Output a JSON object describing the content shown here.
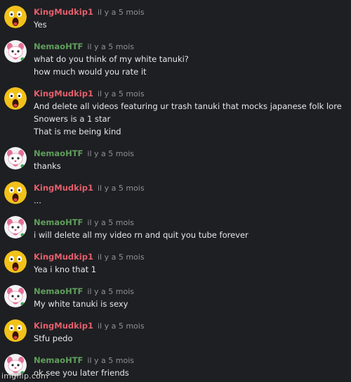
{
  "messages": [
    {
      "author": "KingMudkip1",
      "time": "il y a 5 mois",
      "lines": [
        "Yes"
      ]
    },
    {
      "author": "NemaoHTF",
      "time": "il y a 5 mois",
      "lines": [
        "what do you think of my white tanuki?",
        "how much would you rate it"
      ]
    },
    {
      "author": "KingMudkip1",
      "time": "il y a 5 mois",
      "lines": [
        "And delete all videos featuring ur trash tanuki that mocks japanese folk lore",
        "Snowers is a 1 star",
        "That is me being kind"
      ]
    },
    {
      "author": "NemaoHTF",
      "time": "il y a 5 mois",
      "lines": [
        "thanks"
      ]
    },
    {
      "author": "KingMudkip1",
      "time": "il y a 5 mois",
      "lines": [
        "..."
      ]
    },
    {
      "author": "NemaoHTF",
      "time": "il y a 5 mois",
      "lines": [
        "i will delete all my video rn and quit you tube forever"
      ]
    },
    {
      "author": "KingMudkip1",
      "time": "il y a 5 mois",
      "lines": [
        "Yea i kno that 1"
      ]
    },
    {
      "author": "NemaoHTF",
      "time": "il y a 5 mois",
      "lines": [
        "My white tanuki is sexy"
      ]
    },
    {
      "author": "KingMudkip1",
      "time": "il y a 5 mois",
      "lines": [
        "Stfu pedo"
      ]
    },
    {
      "author": "NemaoHTF",
      "time": "il y a 5 mois",
      "lines": [
        "ok see you later friends"
      ]
    }
  ],
  "watermark": "imgflip.com",
  "colors": {
    "background": "#1e1f22",
    "kingmudkip_name": "#e45f6c",
    "nemao_name": "#5fa05c",
    "timestamp": "#8e9196",
    "text": "#e6e7ea"
  },
  "icons": {
    "kingmudkip_avatar": "screaming-yellow-face-icon",
    "nemao_avatar": "pink-white-tanuki-avatar-icon"
  }
}
